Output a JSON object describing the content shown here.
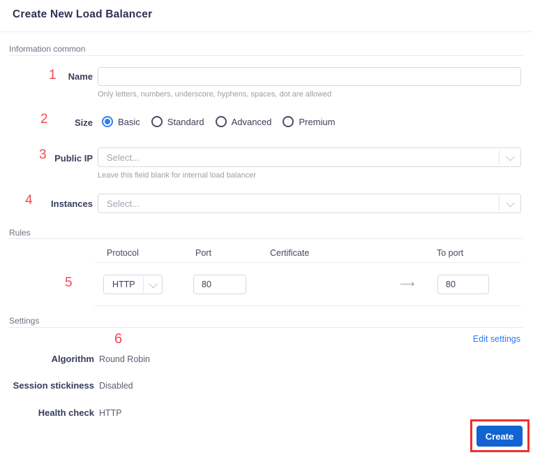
{
  "header": {
    "title": "Create New Load Balancer"
  },
  "sections": {
    "information": "Information common",
    "rules": "Rules",
    "settings": "Settings"
  },
  "form": {
    "name": {
      "label": "Name",
      "value": "",
      "helper": "Only letters, numbers, underscore, hyphens, spaces, dot are allowed"
    },
    "size": {
      "label": "Size",
      "selected": "Basic",
      "options": [
        "Basic",
        "Standard",
        "Advanced",
        "Premium"
      ]
    },
    "public_ip": {
      "label": "Public IP",
      "placeholder": "Select...",
      "helper": "Leave this field blank for internal load balancer"
    },
    "instances": {
      "label": "Instances",
      "placeholder": "Select..."
    }
  },
  "rules_table": {
    "headers": [
      "Protocol",
      "Port",
      "Certificate",
      "To port"
    ],
    "row": {
      "protocol": "HTTP",
      "port": "80",
      "certificate": "",
      "to_port": "80",
      "arrow": "⟶"
    }
  },
  "settings": {
    "edit_link": "Edit settings",
    "rows": [
      {
        "label": "Algorithm",
        "value": "Round Robin"
      },
      {
        "label": "Session stickiness",
        "value": "Disabled"
      },
      {
        "label": "Health check",
        "value": "HTTP"
      }
    ]
  },
  "actions": {
    "create": "Create"
  },
  "annotations": {
    "numbers": [
      "1",
      "2",
      "3",
      "4",
      "5",
      "6"
    ]
  },
  "colors": {
    "primary_button": "#1164d2",
    "link": "#2d7bf5",
    "annotation_red": "#f12e2e",
    "annotation_number_red": "#ef4b51",
    "radio_selected": "#2f80ed"
  }
}
